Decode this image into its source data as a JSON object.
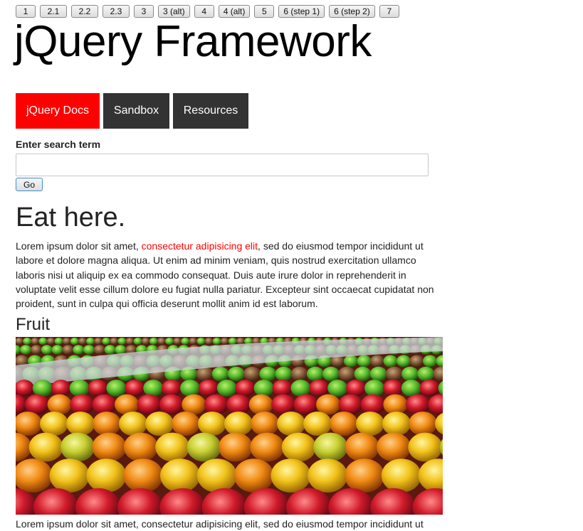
{
  "step_buttons": [
    "1",
    "2.1",
    "2.2",
    "2.3",
    "3",
    "3 (alt)",
    "4",
    "4 (alt)",
    "5",
    "6 (step 1)",
    "6 (step 2)",
    "7"
  ],
  "site_title": "jQuery Framework",
  "nav": [
    {
      "label": "jQuery Docs",
      "active": true
    },
    {
      "label": "Sandbox",
      "active": false
    },
    {
      "label": "Resources",
      "active": false
    }
  ],
  "search": {
    "label": "Enter search term",
    "value": "",
    "button": "Go"
  },
  "main": {
    "heading": "Eat here.",
    "para1_before": "Lorem ipsum dolor sit amet, ",
    "para1_link": "consectetur adipisicing elit",
    "para1_after": ", sed do eiusmod tempor incididunt ut labore et dolore magna aliqua. Ut enim ad minim veniam, quis nostrud exercitation ullamco laboris nisi ut aliquip ex ea commodo consequat. Duis aute irure dolor in reprehenderit in voluptate velit esse cillum dolore eu fugiat nulla pariatur. Excepteur sint occaecat cupidatat non proident, sunt in culpa qui officia deserunt mollit anim id est laborum.",
    "fruit_heading": "Fruit",
    "para2": "Lorem ipsum dolor sit amet, consectetur adipisicing elit, sed do eiusmod tempor incididunt ut"
  },
  "colors": {
    "accent": "#ff0000",
    "nav_bg": "#333333"
  }
}
